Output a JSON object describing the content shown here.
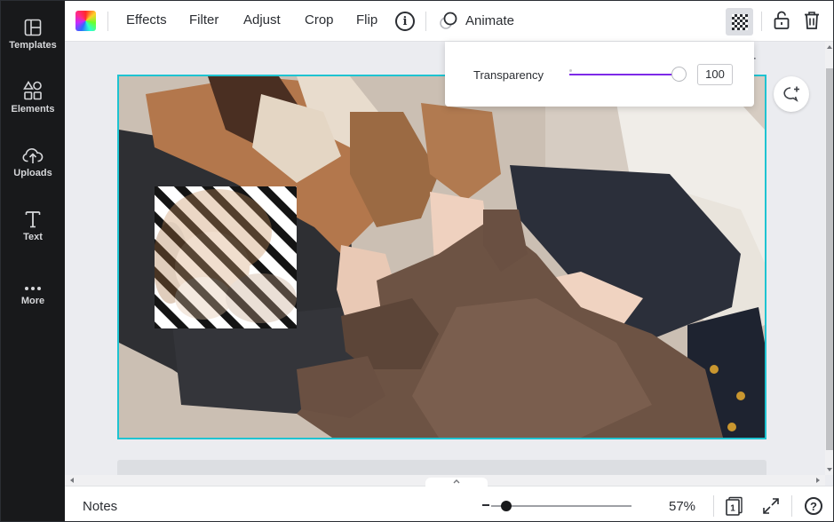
{
  "sidebar": {
    "items": [
      {
        "label": "Templates",
        "icon": "templates-icon"
      },
      {
        "label": "Elements",
        "icon": "elements-icon"
      },
      {
        "label": "Uploads",
        "icon": "uploads-icon"
      },
      {
        "label": "Text",
        "icon": "text-icon"
      },
      {
        "label": "More",
        "icon": "more-icon"
      }
    ]
  },
  "toolbar": {
    "color_icon": "color-palette-icon",
    "buttons": {
      "effects": "Effects",
      "filter": "Filter",
      "adjust": "Adjust",
      "crop": "Crop",
      "flip": "Flip"
    },
    "info_icon": "info-icon",
    "info_glyph": "i",
    "animate_label": "Animate",
    "transparency_icon": "transparency-icon",
    "lock_icon": "lock-icon",
    "trash_icon": "trash-icon"
  },
  "transparency_popover": {
    "label": "Transparency",
    "value": "100",
    "slider_fraction": 1.0,
    "accent_color": "#7d2ae8"
  },
  "canvas": {
    "selection_color": "#1ec3d1",
    "photo_description_icon": "photo-image",
    "overlay_icon": "striped-dog-image",
    "comment_icon": "add-comment-icon",
    "add_page_glyph": "+"
  },
  "footer": {
    "notes_label": "Notes",
    "expand_glyph": "^",
    "zoom_level": "57%",
    "zoom_fraction": 0.07,
    "page_count": "1",
    "help_glyph": "?"
  }
}
